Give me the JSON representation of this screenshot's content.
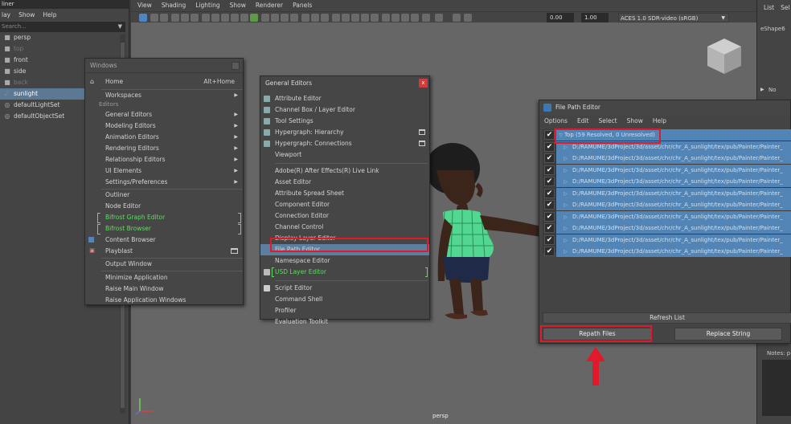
{
  "outliner": {
    "title": "liner",
    "menu": [
      "lay",
      "Show",
      "Help"
    ],
    "search_placeholder": "Search...",
    "items": [
      {
        "label": "persp",
        "icon": "camera-icon",
        "dim": false,
        "selected": false
      },
      {
        "label": "top",
        "icon": "camera-icon",
        "dim": true,
        "selected": false
      },
      {
        "label": "front",
        "icon": "camera-icon",
        "dim": false,
        "selected": false
      },
      {
        "label": "side",
        "icon": "camera-icon",
        "dim": false,
        "selected": false
      },
      {
        "label": "back",
        "icon": "camera-icon",
        "dim": true,
        "selected": false
      },
      {
        "label": "sunlight",
        "icon": "directional-light-icon",
        "dim": false,
        "selected": true
      },
      {
        "label": "defaultLightSet",
        "icon": "set-icon",
        "dim": false,
        "selected": false
      },
      {
        "label": "defaultObjectSet",
        "icon": "set-icon",
        "dim": false,
        "selected": false
      }
    ]
  },
  "viewport": {
    "menu": [
      "View",
      "Shading",
      "Lighting",
      "Show",
      "Renderer",
      "Panels"
    ],
    "exposure_value": "0.00",
    "gamma_value": "1.00",
    "color_space": "ACES 1.0 SDR-video (sRGB)",
    "camera_label": "persp",
    "viewcube_icon": "viewcube-icon"
  },
  "rightpanel": {
    "tabs": [
      "List",
      "Sel"
    ],
    "shape_label": "eShape6",
    "no_label": "No",
    "notes_label": "Notes: p"
  },
  "windows_menu": {
    "title": "Windows",
    "home": {
      "label": "Home",
      "shortcut": "Alt+Home"
    },
    "workspaces": "Workspaces",
    "editors_section": "Editors",
    "submenus": [
      "General Editors",
      "Modeling Editors",
      "Animation Editors",
      "Rendering Editors",
      "Relationship Editors",
      "UI Elements",
      "Settings/Preferences"
    ],
    "items_a": [
      "Outliner",
      "Node Editor"
    ],
    "bifrost": [
      "Bifrost Graph Editor",
      "Bifrost Browser"
    ],
    "items_b": [
      "Content Browser",
      "Playblast"
    ],
    "output_window": "Output Window",
    "app_items": [
      "Minimize Application",
      "Raise Main Window",
      "Raise Application Windows"
    ]
  },
  "general_editors": {
    "title": "General Editors",
    "close": "x",
    "group1": [
      "Attribute Editor",
      "Channel Box / Layer Editor",
      "Tool Settings",
      "Hypergraph: Hierarchy",
      "Hypergraph: Connections",
      "Viewport"
    ],
    "group2": [
      "Adobe(R) After Effects(R) Live Link",
      "Asset Editor",
      "Attribute Spread Sheet",
      "Component Editor",
      "Connection Editor",
      "Channel Control",
      "Display Layer Editor",
      "File Path Editor",
      "Namespace Editor",
      "USD Layer Editor"
    ],
    "group3": [
      "Script Editor",
      "Command Shell",
      "Profiler",
      "Evaluation Toolkit"
    ],
    "highlighted": "File Path Editor"
  },
  "file_path_editor": {
    "title": "File Path Editor",
    "menu": [
      "Options",
      "Edit",
      "Select",
      "Show",
      "Help"
    ],
    "root_label": "Top (59 Resolved, 0 Unresolved)",
    "paths": [
      "D:/RAMUME/3dProject/3d/asset/chr/chr_A_sunlight/tex/pub/Painter/Painter_",
      "D:/RAMUME/3dProject/3d/asset/chr/chr_A_sunlight/tex/pub/Painter/Painter_",
      "D:/RAMUME/3dProject/3d/asset/chr/chr_A_sunlight/tex/pub/Painter/Painter_",
      "D:/RAMUME/3dProject/3d/asset/chr/chr_A_sunlight/tex/pub/Painter/Painter_",
      "D:/RAMUME/3dProject/3d/asset/chr/chr_A_sunlight/tex/pub/Painter/Painter_",
      "D:/RAMUME/3dProject/3d/asset/chr/chr_A_sunlight/tex/pub/Painter/Painter_",
      "D:/RAMUME/3dProject/3d/asset/chr/chr_A_sunlight/tex/pub/Painter/Painter_",
      "D:/RAMUME/3dProject/3d/asset/chr/chr_A_sunlight/tex/pub/Painter/Painter_",
      "D:/RAMUME/3dProject/3d/asset/chr/chr_A_sunlight/tex/pub/Painter/Painter_",
      "D:/RAMUME/3dProject/3d/asset/chr/chr_A_sunlight/tex/pub/Painter/Painter_"
    ],
    "refresh_label": "Refresh List",
    "repath_label": "Repath Files",
    "replace_label": "Replace String"
  },
  "colors": {
    "highlight_red": "#e0192b",
    "selection_blue": "#5285b5",
    "bifrost_green": "#5dde5d"
  }
}
